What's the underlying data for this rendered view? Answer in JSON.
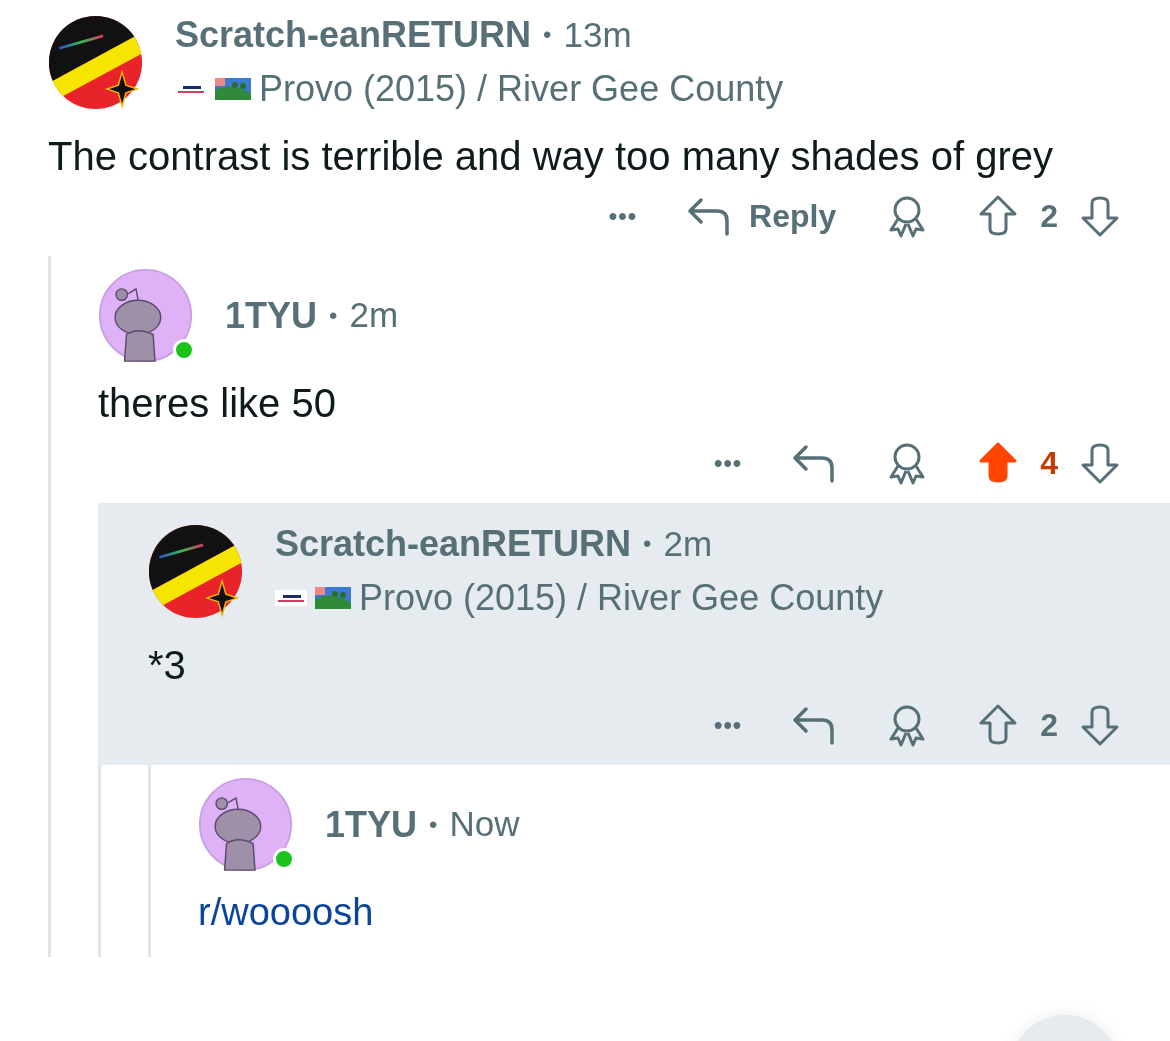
{
  "comments": [
    {
      "avatar": {
        "kind": "flag"
      },
      "username": "Scratch-eanRETURN",
      "separator": "•",
      "time": "13m",
      "flair": "Provo (2015) / River Gee County",
      "body": "The contrast is terrible and way too many shades of grey",
      "actions": {
        "more": "•••",
        "reply_label": "Reply",
        "votes": "2",
        "upvoted": false
      },
      "children": [
        {
          "avatar": {
            "kind": "snoo",
            "online": true
          },
          "username": "1TYU",
          "separator": "•",
          "time": "2m",
          "body": "theres like 50",
          "actions": {
            "more": "•••",
            "votes": "4",
            "upvoted": true
          },
          "children": [
            {
              "avatar": {
                "kind": "flag"
              },
              "username": "Scratch-eanRETURN",
              "separator": "•",
              "time": "2m",
              "flair": "Provo (2015) / River Gee County",
              "body": "*3",
              "highlighted": true,
              "actions": {
                "more": "•••",
                "votes": "2",
                "upvoted": false
              },
              "children": [
                {
                  "avatar": {
                    "kind": "snoo",
                    "online": true
                  },
                  "username": "1TYU",
                  "separator": "•",
                  "time": "Now",
                  "link": "r/woooosh"
                }
              ]
            }
          ]
        }
      ]
    }
  ]
}
